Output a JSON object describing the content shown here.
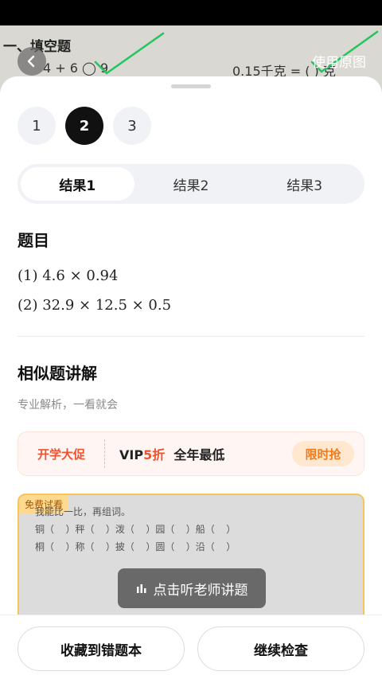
{
  "background_photo": {
    "title": "一、填空题",
    "equation_left": "4 + 6 ◯ 9",
    "equation_right": "0.15千克 = (  ) 克"
  },
  "header": {
    "back_icon": "chevron-left-icon",
    "use_original_label": "使用原图"
  },
  "page_tabs": [
    {
      "label": "1",
      "active": false
    },
    {
      "label": "2",
      "active": true
    },
    {
      "label": "3",
      "active": false
    }
  ],
  "result_tabs": [
    {
      "label": "结果1",
      "active": true
    },
    {
      "label": "结果2",
      "active": false
    },
    {
      "label": "结果3",
      "active": false
    }
  ],
  "question": {
    "title": "题目",
    "lines": [
      "(1) 4.6 × 0.94",
      "(2) 32.9 × 12.5 × 0.5"
    ]
  },
  "similar": {
    "title": "相似题讲解",
    "subtitle": "专业解析，一看就会"
  },
  "promo": {
    "left_label": "开学大促",
    "vip_prefix": "VIP",
    "vip_discount": "5折",
    "vip_suffix": "全年最低",
    "button_label": "限时抢",
    "accent_color": "#f0522f"
  },
  "video": {
    "badge": "免费试看",
    "handwriting": [
      "我能比一比，再组词。",
      "铜（  ）秤（  ）泼（  ）园（  ）船（  ）",
      "桐（  ）称（  ）披（  ）圆（  ）沿（  ）"
    ],
    "listen_label": "点击听老师讲题",
    "listen_icon": "audio-bars-icon"
  },
  "bottom": {
    "save_label": "收藏到错题本",
    "continue_label": "继续检查"
  }
}
